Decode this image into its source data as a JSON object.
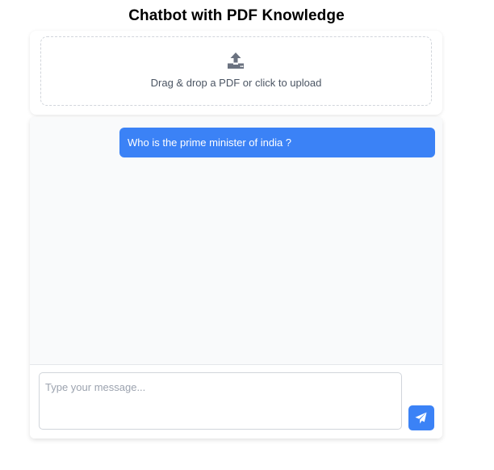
{
  "header": {
    "title": "Chatbot with PDF Knowledge"
  },
  "upload": {
    "icon": "upload-icon",
    "text": "Drag & drop a PDF or click to upload"
  },
  "chat": {
    "messages": [
      {
        "role": "user",
        "text": "Who is the prime minister of india ?"
      }
    ]
  },
  "composer": {
    "placeholder": "Type your message...",
    "value": "",
    "send_icon": "send-icon"
  },
  "colors": {
    "accent": "#3b82f6",
    "chat_background": "#f9fafb",
    "muted_text": "#4b5563",
    "icon_gray": "#6b7280"
  }
}
